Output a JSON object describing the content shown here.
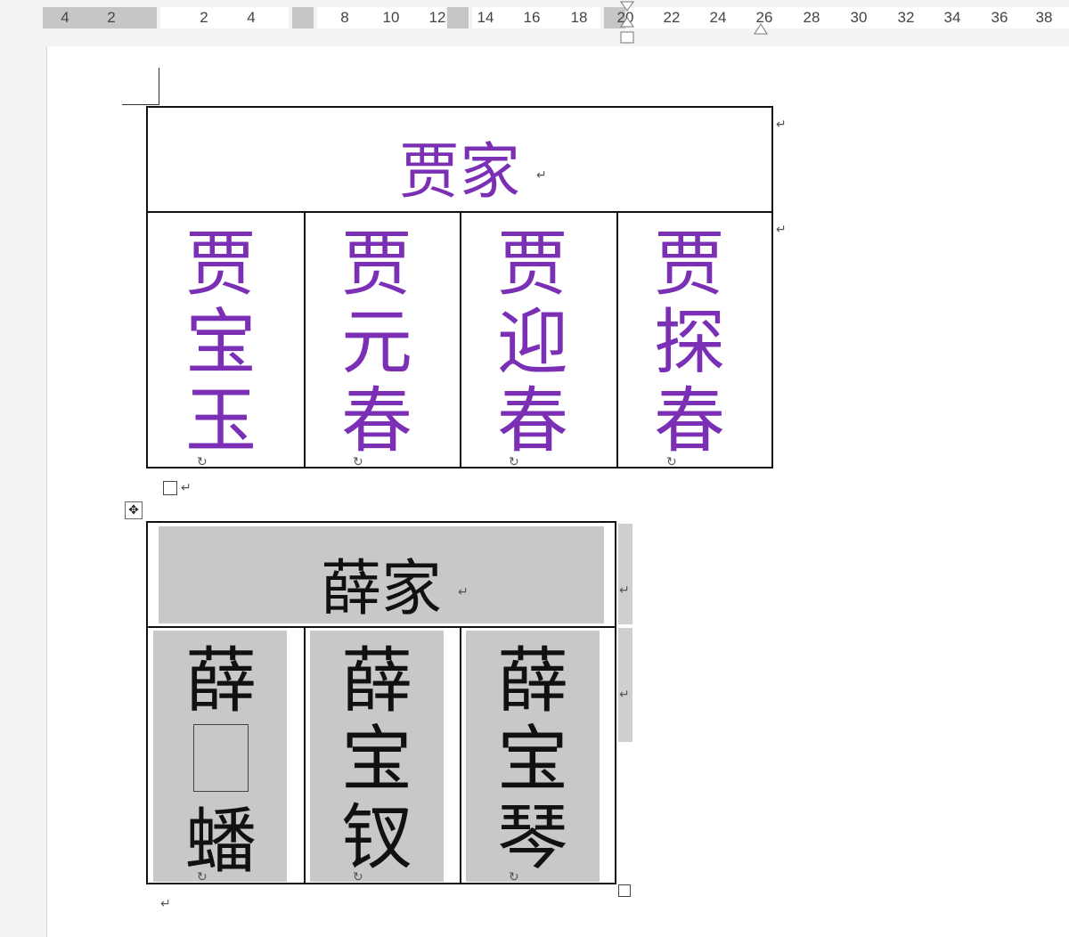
{
  "ruler": {
    "numbers": [
      "4",
      "2",
      "2",
      "4",
      "8",
      "10",
      "12",
      "14",
      "16",
      "18",
      "20",
      "22",
      "24",
      "26",
      "28",
      "30",
      "32",
      "34",
      "36",
      "38"
    ]
  },
  "jia_table": {
    "title": "贾家",
    "columns": [
      {
        "chars": [
          "贾",
          "宝",
          "玉"
        ]
      },
      {
        "chars": [
          "贾",
          "元",
          "春"
        ]
      },
      {
        "chars": [
          "贾",
          "迎",
          "春"
        ]
      },
      {
        "chars": [
          "贾",
          "探",
          "春"
        ]
      }
    ],
    "color": "#7a2fb5"
  },
  "xue_table": {
    "title": "薛家",
    "columns": [
      {
        "chars": [
          "薛",
          "",
          "蟠"
        ]
      },
      {
        "chars": [
          "薛",
          "宝",
          "钗"
        ]
      },
      {
        "chars": [
          "薛",
          "宝",
          "琴"
        ]
      }
    ],
    "shade_color": "#c8c8c8"
  },
  "marks": {
    "paragraph": "↵",
    "cell_end": "↻"
  }
}
